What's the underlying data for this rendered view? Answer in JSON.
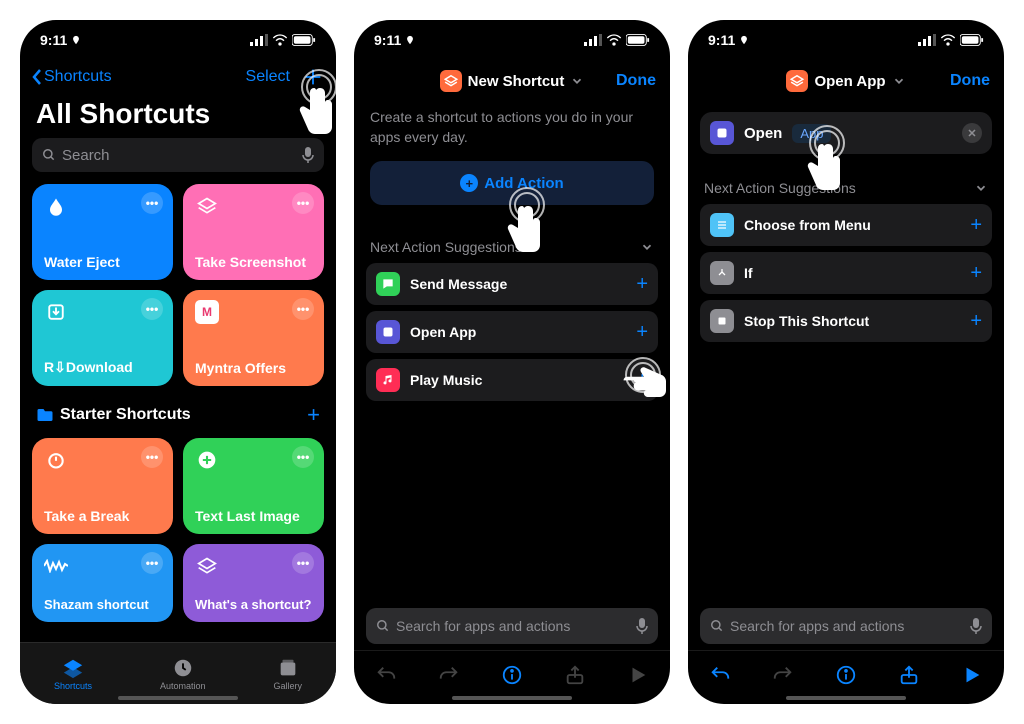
{
  "status": {
    "time": "9:11",
    "bars": 4
  },
  "screen1": {
    "back_label": "Shortcuts",
    "select_label": "Select",
    "title": "All Shortcuts",
    "search_placeholder": "Search",
    "tiles": [
      {
        "label": "Water Eject",
        "color": "#0a84ff"
      },
      {
        "label": "Take Screenshot",
        "color": "#ff6fb5"
      },
      {
        "label": "R⇩Download",
        "color": "#1fc7d4"
      },
      {
        "label": "Myntra Offers",
        "color": "#ff7a4d"
      }
    ],
    "starter_label": "Starter Shortcuts",
    "starter_tiles": [
      {
        "label": "Take a Break",
        "color": "#ff7a4d"
      },
      {
        "label": "Text Last Image",
        "color": "#30d158"
      },
      {
        "label": "Shazam shortcut",
        "color": "#2196f3"
      },
      {
        "label": "What's a shortcut?",
        "color": "#8e5bd8"
      }
    ],
    "tabs": [
      {
        "label": "Shortcuts"
      },
      {
        "label": "Automation"
      },
      {
        "label": "Gallery"
      }
    ]
  },
  "screen2": {
    "title": "New Shortcut",
    "done": "Done",
    "subtitle": "Create a shortcut to actions you do in your apps every day.",
    "add_action": "Add Action",
    "suggestions_header": "Next Action Suggestions",
    "suggestions": [
      {
        "label": "Send Message",
        "color": "#30d158"
      },
      {
        "label": "Open App",
        "color": "#5856d6"
      },
      {
        "label": "Play Music",
        "color": "#ff2d55"
      }
    ],
    "search_placeholder": "Search for apps and actions"
  },
  "screen3": {
    "title": "Open App",
    "done": "Done",
    "action_verb": "Open",
    "action_param": "App",
    "suggestions_header": "Next Action Suggestions",
    "suggestions": [
      {
        "label": "Choose from Menu",
        "color": "#4fc3f7"
      },
      {
        "label": "If",
        "color": "#8e8e93"
      },
      {
        "label": "Stop This Shortcut",
        "color": "#8e8e93"
      }
    ],
    "search_placeholder": "Search for apps and actions"
  }
}
